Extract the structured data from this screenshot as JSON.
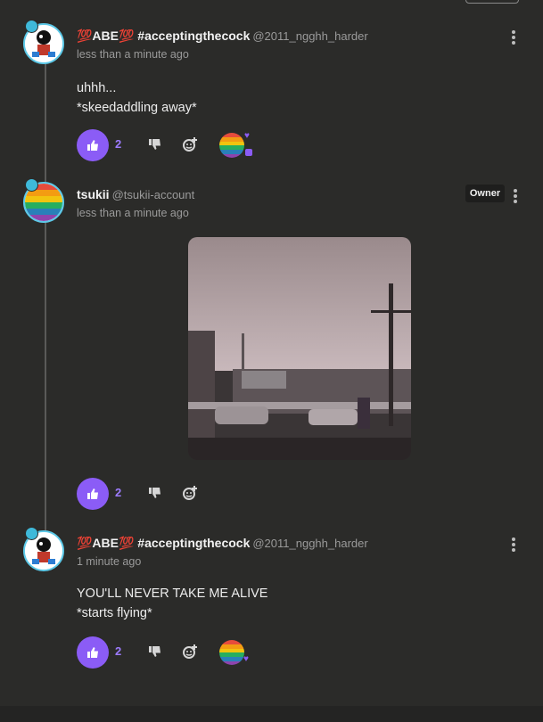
{
  "posts": [
    {
      "display_name": "💯ABE💯 #acceptingthecock",
      "handle": "@2011_ngghh_harder",
      "timestamp": "less than a minute ago",
      "lines": [
        "uhhh...",
        "*skeedaddling away*"
      ],
      "likes": "2"
    },
    {
      "display_name": "tsukii",
      "handle": "@tsukii-account",
      "badge": "Owner",
      "timestamp": "less than a minute ago",
      "likes": "2"
    },
    {
      "display_name": "💯ABE💯 #acceptingthecock",
      "handle": "@2011_ngghh_harder",
      "timestamp": "1 minute ago",
      "lines": [
        "YOU'LL NEVER TAKE ME ALIVE",
        "*starts flying*"
      ],
      "likes": "2"
    }
  ],
  "icons": {
    "like": "thumbs-up-icon",
    "dislike": "thumbs-down-icon",
    "add_reaction": "add-reaction-icon",
    "more": "more-options-icon"
  },
  "colors": {
    "background": "#2b2b29",
    "accent": "#8b5cf6",
    "avatar_ring": "#5cc9e8"
  }
}
